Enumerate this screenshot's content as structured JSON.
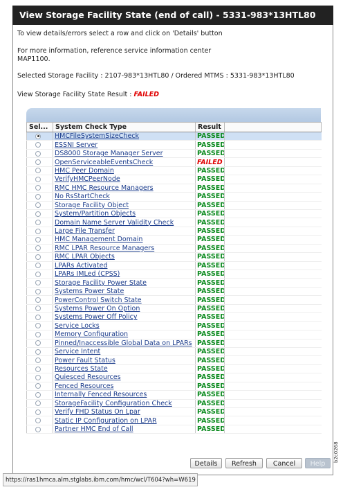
{
  "window": {
    "title": "View Storage Facility State (end of call) - 5331-983*13HTL80"
  },
  "info": {
    "instructions": "To view details/errors select a row and click on 'Details' button",
    "reference_line1": "For more information, reference service information center",
    "reference_line2": "MAP1100.",
    "selected_facility": "Selected Storage Facility : 2107-983*13HTL80 / Ordered MTMS : 5331-983*13HTL80",
    "result_label": "View Storage Facility State Result :",
    "result_value": "FAILED"
  },
  "table": {
    "columns": [
      "Sel...",
      "System Check Type",
      "Result"
    ],
    "rows": [
      {
        "check": "HMCFileSystemSizeCheck",
        "result": "PASSED",
        "selected": true
      },
      {
        "check": "ESSNI Server",
        "result": "PASSED"
      },
      {
        "check": "DS8000 Storage Manager Server",
        "result": "PASSED"
      },
      {
        "check": "OpenServiceableEventsCheck",
        "result": "FAILED"
      },
      {
        "check": "HMC Peer Domain",
        "result": "PASSED"
      },
      {
        "check": "VerifyHMCPeerNode",
        "result": "PASSED"
      },
      {
        "check": "RMC HMC Resource Managers",
        "result": "PASSED"
      },
      {
        "check": "No RsStartCheck",
        "result": "PASSED"
      },
      {
        "check": "Storage Facility Object",
        "result": "PASSED"
      },
      {
        "check": "System/Partition Objects",
        "result": "PASSED"
      },
      {
        "check": "Domain Name Server Validity Check",
        "result": "PASSED"
      },
      {
        "check": "Large File Transfer",
        "result": "PASSED"
      },
      {
        "check": "HMC Management Domain",
        "result": "PASSED"
      },
      {
        "check": "RMC LPAR Resource Managers",
        "result": "PASSED"
      },
      {
        "check": "RMC LPAR Objects",
        "result": "PASSED"
      },
      {
        "check": "LPARs Activated",
        "result": "PASSED"
      },
      {
        "check": "LPARs IMLed (CPSS)",
        "result": "PASSED"
      },
      {
        "check": "Storage Facility Power State",
        "result": "PASSED"
      },
      {
        "check": "Systems Power State",
        "result": "PASSED"
      },
      {
        "check": "PowerControl Switch State",
        "result": "PASSED"
      },
      {
        "check": "Systems Power On Option",
        "result": "PASSED"
      },
      {
        "check": "Systems Power Off Policy",
        "result": "PASSED"
      },
      {
        "check": "Service Locks",
        "result": "PASSED"
      },
      {
        "check": "Memory Configuration",
        "result": "PASSED"
      },
      {
        "check": "Pinned/Inaccessible Global Data on LPARs",
        "result": "PASSED"
      },
      {
        "check": "Service Intent",
        "result": "PASSED"
      },
      {
        "check": "Power Fault Status",
        "result": "PASSED"
      },
      {
        "check": "Resources State",
        "result": "PASSED"
      },
      {
        "check": "Quiesced Resources",
        "result": "PASSED"
      },
      {
        "check": "Fenced Resources",
        "result": "PASSED"
      },
      {
        "check": "Internally Fenced Resources",
        "result": "PASSED"
      },
      {
        "check": "StorageFacility Configuration Check",
        "result": "PASSED"
      },
      {
        "check": "Verify FHD Status On Lpar",
        "result": "PASSED"
      },
      {
        "check": "Static IP Configuration on LPAR",
        "result": "PASSED"
      },
      {
        "check": "Partner HMC End of Call",
        "result": "PASSED"
      }
    ]
  },
  "buttons": {
    "details": "Details",
    "refresh": "Refresh",
    "cancel": "Cancel",
    "help": "Help"
  },
  "statusbar": {
    "url": "https://ras1hmca.alm.stglabs.ibm.com/hmc/wcl/T604?wh=W619"
  },
  "figure_id": "b2c0268",
  "colors": {
    "title_bg": "#222222",
    "passed": "#0b8a1e",
    "failed": "#e00000",
    "link": "#1a3b8b",
    "selected_row": "#cfe0f4"
  }
}
